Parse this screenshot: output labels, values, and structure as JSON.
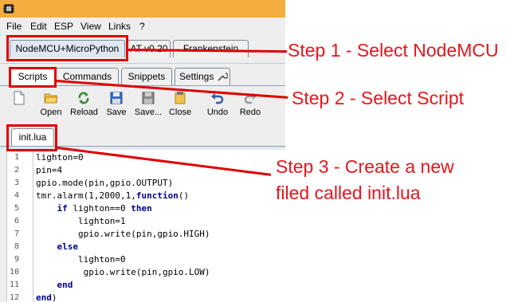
{
  "menu": {
    "items": [
      "File",
      "Edit",
      "ESP",
      "View",
      "Links",
      "?"
    ]
  },
  "port_tabs": [
    "NodeMCU+MicroPython",
    "AT v0.20",
    "Frankenstein"
  ],
  "sub_tabs": [
    "Scripts",
    "Commands",
    "Snippets",
    "Settings"
  ],
  "toolbar": {
    "open": "Open",
    "reload": "Reload",
    "save": "Save",
    "save_to_esp": "Save...",
    "close": "Close",
    "undo": "Undo",
    "redo": "Redo"
  },
  "file_tab": "init.lua",
  "code": {
    "line_numbers": [
      "1",
      "2",
      "3",
      "4",
      "5",
      "6",
      "7",
      "8",
      "9",
      "10",
      "11",
      "12"
    ],
    "lines": [
      "lighton=0",
      "pin=4",
      "gpio.mode(pin,gpio.OUTPUT)",
      "tmr.alarm(1,2000,1,function()",
      "    if lighton==0 then",
      "        lighton=1",
      "        gpio.write(pin,gpio.HIGH)",
      "    else",
      "        lighton=0",
      "         gpio.write(pin,gpio.LOW)",
      "    end",
      "end)"
    ]
  },
  "annotations": {
    "step1": "Step 1 - Select NodeMCU",
    "step2": "Step 2 - Select Script",
    "step3_line1": "Step 3 - Create a new",
    "step3_line2": "filed called init.lua"
  },
  "colors": {
    "annotation": "#e8141c",
    "titlebar": "#f4ad3f",
    "keyword": "#00008b"
  }
}
